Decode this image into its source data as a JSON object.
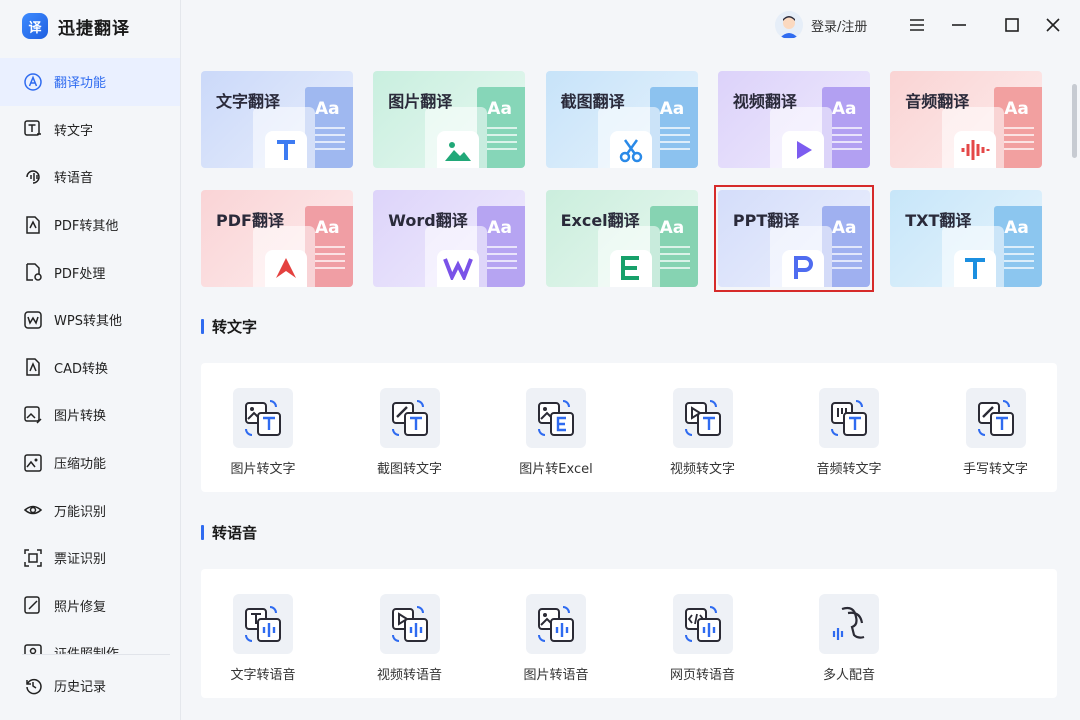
{
  "app": {
    "title": "迅捷翻译",
    "logo_glyph": "译"
  },
  "sidebar": {
    "items": [
      {
        "label": "翻译功能",
        "icon": "translate-a-icon",
        "active": true
      },
      {
        "label": "转文字",
        "icon": "text-t-icon"
      },
      {
        "label": "转语音",
        "icon": "audio-wave-icon"
      },
      {
        "label": "PDF转其他",
        "icon": "pdf-convert-icon"
      },
      {
        "label": "PDF处理",
        "icon": "pdf-gear-icon"
      },
      {
        "label": "WPS转其他",
        "icon": "wps-icon"
      },
      {
        "label": "CAD转换",
        "icon": "cad-icon"
      },
      {
        "label": "图片转换",
        "icon": "image-convert-icon"
      },
      {
        "label": "压缩功能",
        "icon": "compress-icon"
      },
      {
        "label": "万能识别",
        "icon": "eye-icon"
      },
      {
        "label": "票证识别",
        "icon": "ticket-scan-icon"
      },
      {
        "label": "照片修复",
        "icon": "photo-repair-icon"
      },
      {
        "label": "证件照制作",
        "icon": "id-photo-icon"
      }
    ],
    "history": {
      "label": "历史记录",
      "icon": "history-icon"
    }
  },
  "header": {
    "user_label": "登录/注册"
  },
  "translate_cards": [
    {
      "label": "文字翻译",
      "glyph": "T",
      "icon": "text-t-icon",
      "bg": "#cbd9f9",
      "back": "#9fb8f0",
      "accent": "#3d7bf2"
    },
    {
      "label": "图片翻译",
      "glyph": "",
      "icon": "image-icon",
      "bg": "#c9efdf",
      "back": "#86d6b8",
      "accent": "#21a878"
    },
    {
      "label": "截图翻译",
      "glyph": "",
      "icon": "scissors-icon",
      "bg": "#c7e3f9",
      "back": "#8cc2ef",
      "accent": "#2a8ae8"
    },
    {
      "label": "视频翻译",
      "glyph": "",
      "icon": "play-icon",
      "bg": "#dcd2fa",
      "back": "#b2a0f2",
      "accent": "#7c5cf0"
    },
    {
      "label": "音频翻译",
      "glyph": "",
      "icon": "audio-wave-icon",
      "bg": "#fad4d4",
      "back": "#f2a0a0",
      "accent": "#e44848"
    },
    {
      "label": "PDF翻译",
      "glyph": "",
      "icon": "pdf-icon",
      "bg": "#fad4d6",
      "back": "#f09ea4",
      "accent": "#e4413f"
    },
    {
      "label": "Word翻译",
      "glyph": "W",
      "icon": "wps-w-icon",
      "bg": "#ddd4fa",
      "back": "#b6a4f2",
      "accent": "#7a52e8"
    },
    {
      "label": "Excel翻译",
      "glyph": "E",
      "icon": "excel-icon",
      "bg": "#cbeedd",
      "back": "#86d3b2",
      "accent": "#17a06a"
    },
    {
      "label": "PPT翻译",
      "glyph": "P",
      "icon": "ppt-icon",
      "bg": "#d4ddfa",
      "back": "#9fb0f0",
      "accent": "#4f6cf0"
    },
    {
      "label": "TXT翻译",
      "glyph": "T",
      "icon": "txt-t-icon",
      "bg": "#c7e6f9",
      "back": "#8cc6ef",
      "accent": "#1b8fe0"
    }
  ],
  "sections": [
    {
      "title": "转文字",
      "tools": [
        {
          "label": "图片转文字",
          "icon": "image-to-text-icon"
        },
        {
          "label": "截图转文字",
          "icon": "screenshot-to-text-icon"
        },
        {
          "label": "图片转Excel",
          "icon": "image-to-excel-icon"
        },
        {
          "label": "视频转文字",
          "icon": "video-to-text-icon"
        },
        {
          "label": "音频转文字",
          "icon": "audio-to-text-icon"
        },
        {
          "label": "手写转文字",
          "icon": "handwriting-to-text-icon"
        }
      ]
    },
    {
      "title": "转语音",
      "tools": [
        {
          "label": "文字转语音",
          "icon": "text-to-speech-icon"
        },
        {
          "label": "视频转语音",
          "icon": "video-to-speech-icon"
        },
        {
          "label": "图片转语音",
          "icon": "image-to-speech-icon"
        },
        {
          "label": "网页转语音",
          "icon": "web-to-speech-icon"
        },
        {
          "label": "多人配音",
          "icon": "multi-voice-icon"
        }
      ]
    }
  ],
  "colors": {
    "accent": "#2f6bf0",
    "highlight": "#d62a2a"
  }
}
